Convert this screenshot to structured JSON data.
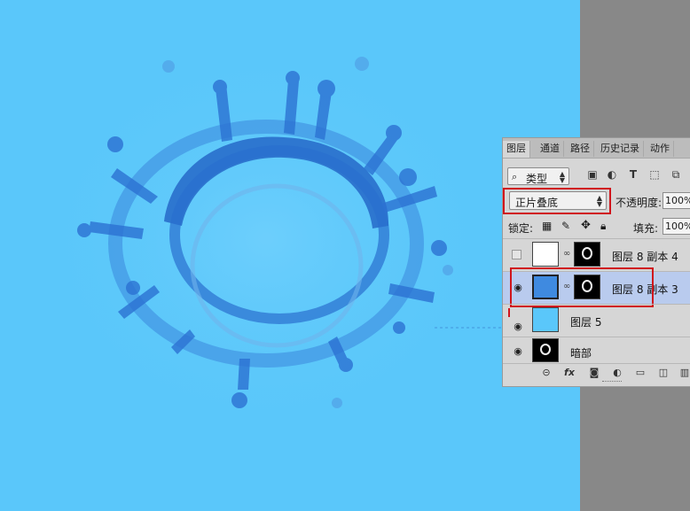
{
  "panel": {
    "tabs": [
      "图层",
      "通道",
      "路径",
      "历史记录",
      "动作"
    ],
    "filter": {
      "label": "类型"
    },
    "blend_mode": "正片叠底",
    "opacity_label": "不透明度:",
    "opacity_value": "100%",
    "lock_label": "锁定:",
    "fill_label": "填充:",
    "fill_value": "100%",
    "layers": [
      {
        "name": "图层 8 副本 4",
        "visible": false,
        "thumb": "white",
        "mask": true,
        "selected": false
      },
      {
        "name": "图层 8 副本 3",
        "visible": true,
        "thumb": "blue",
        "mask": true,
        "selected": true
      },
      {
        "name": "图层 5",
        "visible": true,
        "thumb": "cyan",
        "mask": false,
        "selected": false
      },
      {
        "name": "暗部",
        "visible": true,
        "thumb": "black-splash",
        "mask": false,
        "selected": false
      }
    ]
  },
  "icons": {
    "filter": "search-icon",
    "image_filter": "image-icon",
    "adjustment_filter": "half-circle-icon",
    "type_filter": "text-icon",
    "shape_filter": "shape-icon",
    "smart_filter": "smart-object-icon",
    "visibility": "eye-icon",
    "chain": "link-icon",
    "lock_pixels": "checkerboard-icon",
    "lock_paint": "brush-icon",
    "lock_move": "move-icon",
    "lock_all": "lock-icon",
    "bottom": [
      "link-icon",
      "fx-icon",
      "mask-icon",
      "adjustment-icon",
      "folder-icon",
      "new-layer-icon",
      "trash-icon"
    ]
  },
  "colors": {
    "canvas": "#5ac7fa",
    "splash": "#2f78d6",
    "selection_row": "#b9cbee",
    "highlight": "#d0151c"
  }
}
